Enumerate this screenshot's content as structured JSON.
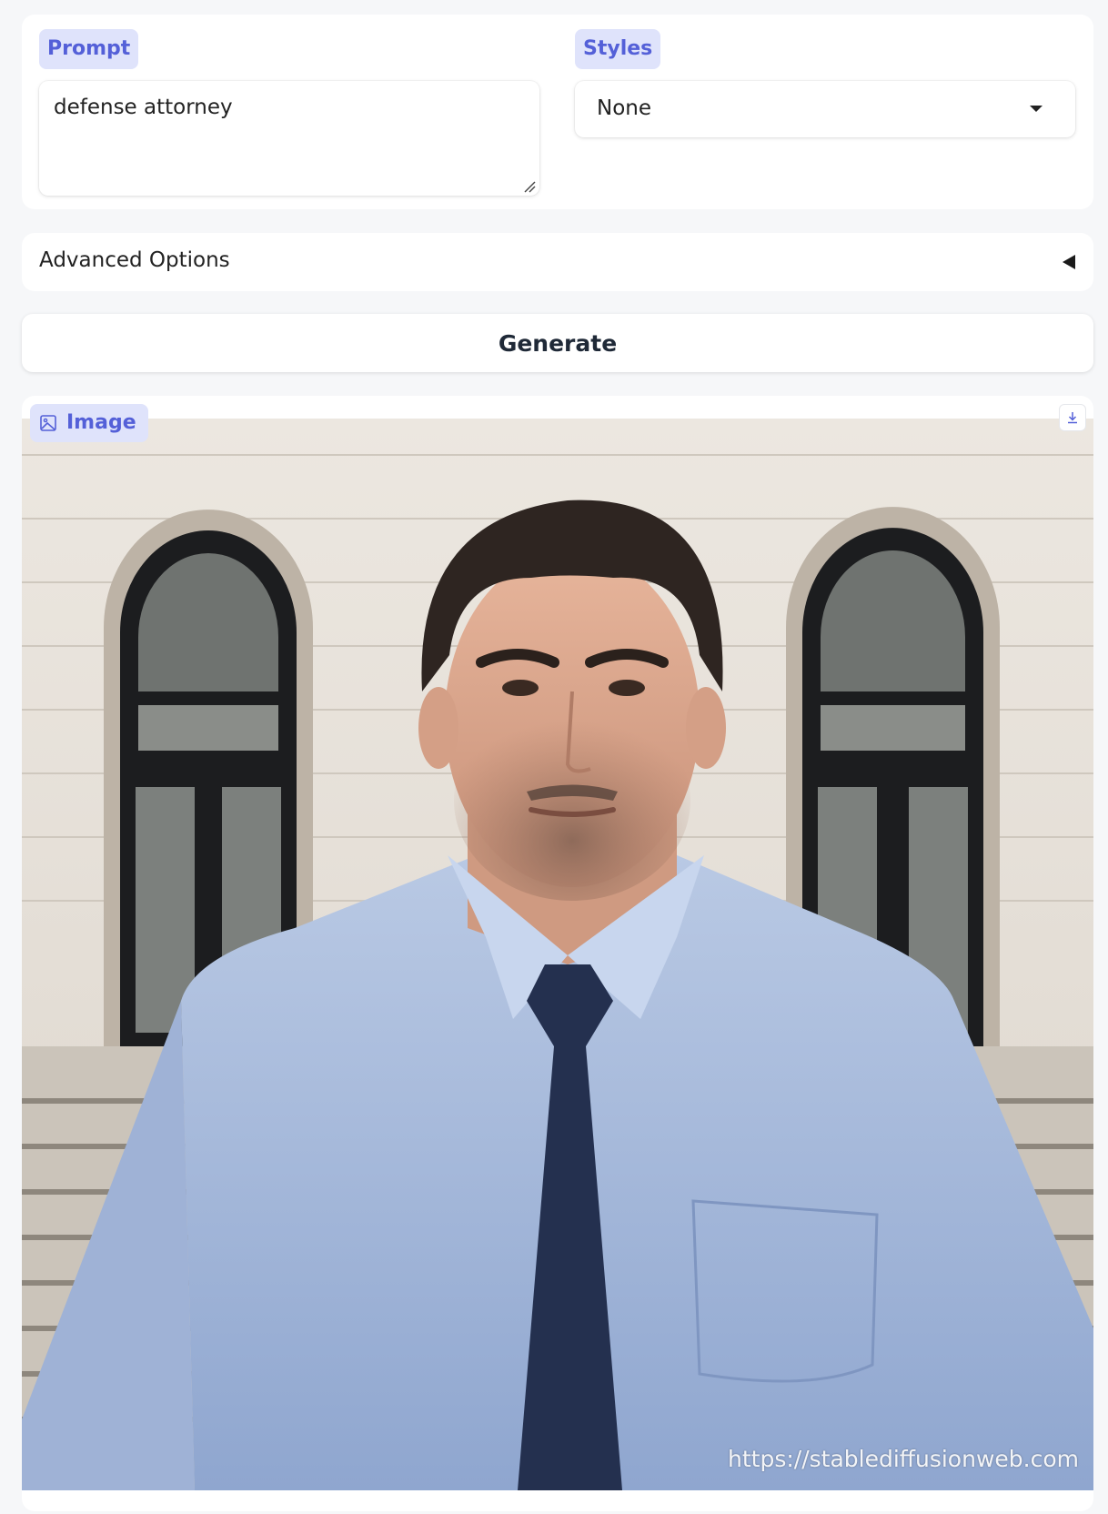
{
  "prompt": {
    "label": "Prompt",
    "value": "defense attorney"
  },
  "styles": {
    "label": "Styles",
    "selected": "None"
  },
  "advanced": {
    "label": "Advanced Options",
    "toggle_icon": "triangle-left-icon"
  },
  "generate": {
    "label": "Generate"
  },
  "output": {
    "label": "Image",
    "label_icon": "image-icon",
    "download_icon": "download-icon",
    "watermark": "https://stablediffusionweb.com"
  },
  "colors": {
    "accent_chip_bg": "#dfe3fb",
    "accent_text": "#5460d8",
    "page_bg": "#f6f7f9",
    "panel_bg": "#ffffff"
  }
}
